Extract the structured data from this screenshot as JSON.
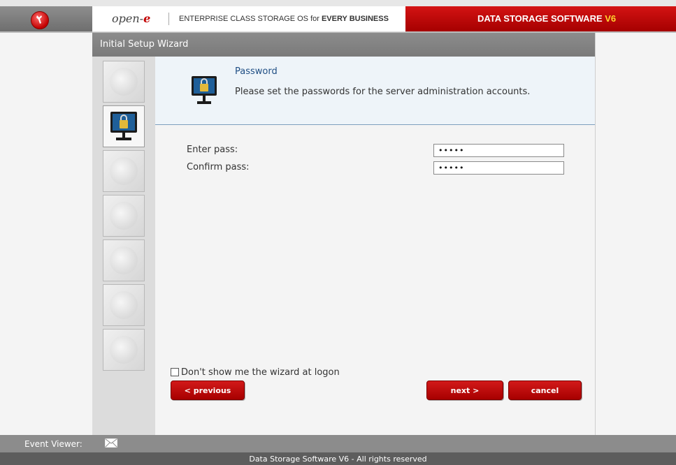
{
  "header": {
    "brand_name": "open-",
    "brand_suffix": "e",
    "slogan_prefix": "ENTERPRISE CLASS STORAGE OS for ",
    "slogan_bold": "EVERY BUSINESS",
    "product_title": "DATA STORAGE SOFTWARE ",
    "product_version": "V6"
  },
  "wizard": {
    "title": "Initial Setup Wizard",
    "step_icons": [
      "globe-icon",
      "monitor-lock-icon",
      "network-globe-icon",
      "tools-icon",
      "keypad-icon",
      "devices-icon",
      "info-icon"
    ],
    "active_step": 2
  },
  "info": {
    "title": "Password",
    "description": "Please set the passwords for the server administration accounts."
  },
  "form": {
    "enter_pass_label": "Enter pass:",
    "enter_pass_value": "•••••",
    "confirm_pass_label": "Confirm pass:",
    "confirm_pass_value": "•••••"
  },
  "options": {
    "dont_show_label": "Don't show me the wizard at logon",
    "dont_show_checked": false
  },
  "buttons": {
    "previous": "< previous",
    "next": "next >",
    "cancel": "cancel"
  },
  "status": {
    "event_viewer_label": "Event Viewer:"
  },
  "footer": {
    "text": "Data Storage Software V6 - All rights reserved"
  },
  "colors": {
    "brand_red": "#c20000",
    "title_blue": "#1f4e84",
    "version_yellow": "#ffd52e"
  }
}
